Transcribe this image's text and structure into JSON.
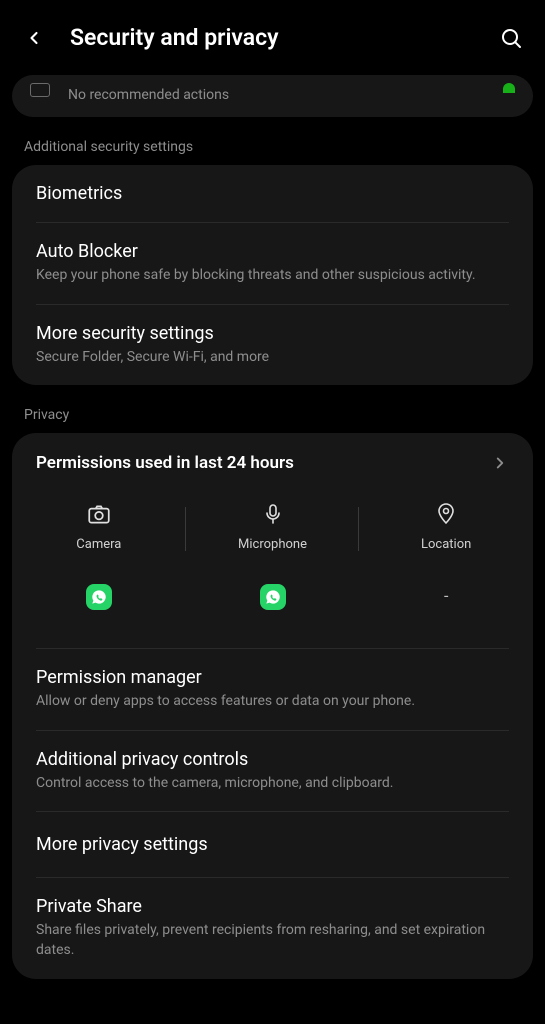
{
  "header": {
    "title": "Security and privacy"
  },
  "topCard": {
    "text": "No recommended actions"
  },
  "sections": {
    "additionalSecurity": {
      "header": "Additional security settings",
      "items": [
        {
          "title": "Biometrics"
        },
        {
          "title": "Auto Blocker",
          "desc": "Keep your phone safe by blocking threats and other suspicious activity."
        },
        {
          "title": "More security settings",
          "desc": "Secure Folder, Secure Wi-Fi, and more"
        }
      ]
    },
    "privacy": {
      "header": "Privacy",
      "permissionsTitle": "Permissions used in last 24 hours",
      "permCols": [
        {
          "label": "Camera",
          "icon": "camera",
          "apps": [
            "whatsapp"
          ]
        },
        {
          "label": "Microphone",
          "icon": "mic",
          "apps": [
            "whatsapp"
          ]
        },
        {
          "label": "Location",
          "icon": "location",
          "apps": []
        }
      ],
      "items": [
        {
          "title": "Permission manager",
          "desc": "Allow or deny apps to access features or data on your phone."
        },
        {
          "title": "Additional privacy controls",
          "desc": "Control access to the camera, microphone, and clipboard."
        },
        {
          "title": "More privacy settings"
        },
        {
          "title": "Private Share",
          "desc": "Share files privately, prevent recipients from resharing, and set expiration dates."
        }
      ]
    }
  }
}
